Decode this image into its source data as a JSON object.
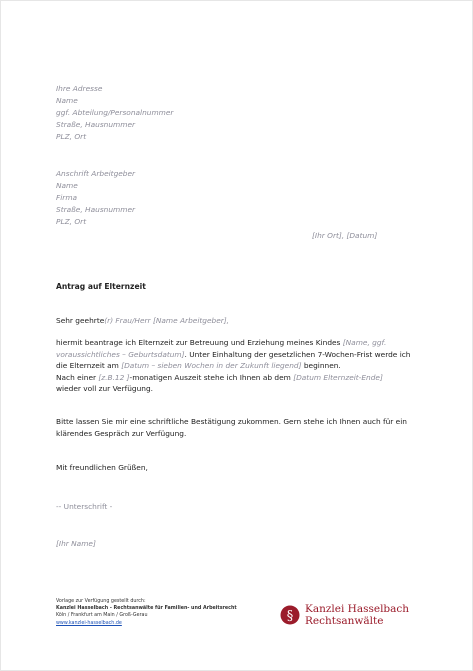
{
  "sender": [
    "Ihre Adresse",
    "Name",
    "ggf. Abteilung/Personalnummer",
    "Straße, Hausnummer",
    "PLZ, Ort"
  ],
  "employer": [
    "Anschrift Arbeitgeber",
    "Name",
    "Firma",
    "Straße, Hausnummer",
    "PLZ, Ort"
  ],
  "place_date": "[Ihr Ort], [Datum]",
  "subject": "Antrag auf Elternzeit",
  "greeting": {
    "text": "Sehr geehrte",
    "placeholder": "(r) Frau/Herr [Name Arbeitgeber],"
  },
  "para1": {
    "t1": "hiermit beantrage ich Elternzeit zur Betreuung und Erziehung meines Kindes ",
    "ph1": "[Name, ggf. voraussichtliches – Geburtsdatum]",
    "t2": ". Unter Einhaltung der gesetzlichen 7-Wochen-Frist werde ich die Elternzeit am ",
    "ph2": "[Datum – sieben Wochen in der Zukunft liegend]",
    "t3": " beginnen.",
    "t4": "Nach einer ",
    "ph3": "[z.B.12 ]",
    "t5": "-monatigen Auszeit stehe ich Ihnen ab dem ",
    "ph4": "[Datum Elternzeit-Ende]",
    "t6": " wieder voll zur Verfügung."
  },
  "para2": "Bitte lassen Sie mir eine schriftliche Bestätigung zukommen. Gern stehe ich Ihnen auch für ein klärendes Gespräch zur Verfügung.",
  "closing": "Mit freundlichen Grüßen,",
  "signature": "-- Unterschrift -",
  "name_placeholder": "[Ihr Name]",
  "footer": {
    "line1": "Vorlage zur Verfügung gestellt durch:",
    "firm": "Kanzlei Hasselbach - Rechtsanwälte für Familien- und Arbeitsrecht",
    "cities": "Köln / Frankfurt am Main / Groß-Gerau",
    "website": "www.kanzlei-hasselbach.de"
  },
  "logo": {
    "line1": "Kanzlei Hasselbach",
    "line2": "Rechtsanwälte",
    "mark": "§",
    "color": "#9b1c2b"
  }
}
